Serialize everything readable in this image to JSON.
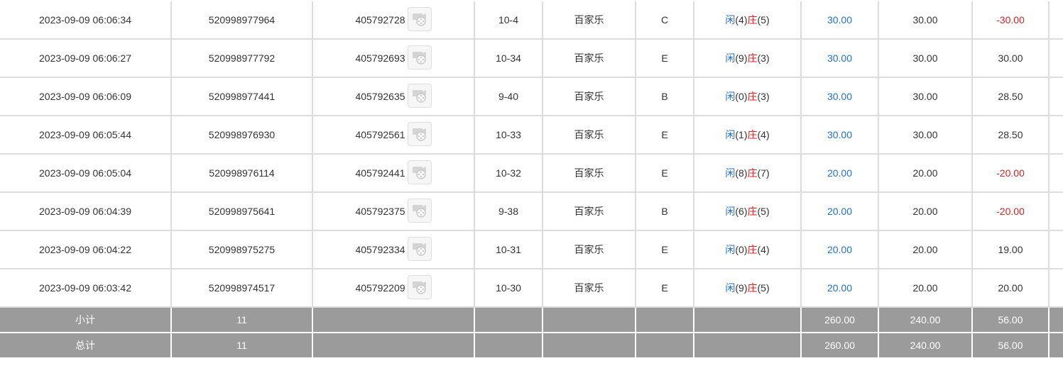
{
  "icons": {
    "video": "video-replay-icon"
  },
  "colors": {
    "bet_amount": "#1f6fd6",
    "negative": "#d82020",
    "summary_bg": "#9b9b9b"
  },
  "rows": [
    {
      "time": "2023-09-09 06:06:34",
      "bet_id": "520998977964",
      "round_id": "405792728",
      "shoe": "10-4",
      "game": "百家乐",
      "table": "C",
      "player_label": "闲",
      "player_score": "(4)",
      "banker_label": "庄",
      "banker_score": "(5)",
      "bet": "30.00",
      "valid_bet": "30.00",
      "win_loss": "-30.00",
      "negative": true
    },
    {
      "time": "2023-09-09 06:06:27",
      "bet_id": "520998977792",
      "round_id": "405792693",
      "shoe": "10-34",
      "game": "百家乐",
      "table": "E",
      "player_label": "闲",
      "player_score": "(9)",
      "banker_label": "庄",
      "banker_score": "(3)",
      "bet": "30.00",
      "valid_bet": "30.00",
      "win_loss": "30.00",
      "negative": false
    },
    {
      "time": "2023-09-09 06:06:09",
      "bet_id": "520998977441",
      "round_id": "405792635",
      "shoe": "9-40",
      "game": "百家乐",
      "table": "B",
      "player_label": "闲",
      "player_score": "(0)",
      "banker_label": "庄",
      "banker_score": "(3)",
      "bet": "30.00",
      "valid_bet": "30.00",
      "win_loss": "28.50",
      "negative": false
    },
    {
      "time": "2023-09-09 06:05:44",
      "bet_id": "520998976930",
      "round_id": "405792561",
      "shoe": "10-33",
      "game": "百家乐",
      "table": "E",
      "player_label": "闲",
      "player_score": "(1)",
      "banker_label": "庄",
      "banker_score": "(4)",
      "bet": "30.00",
      "valid_bet": "30.00",
      "win_loss": "28.50",
      "negative": false
    },
    {
      "time": "2023-09-09 06:05:04",
      "bet_id": "520998976114",
      "round_id": "405792441",
      "shoe": "10-32",
      "game": "百家乐",
      "table": "E",
      "player_label": "闲",
      "player_score": "(8)",
      "banker_label": "庄",
      "banker_score": "(7)",
      "bet": "20.00",
      "valid_bet": "20.00",
      "win_loss": "-20.00",
      "negative": true
    },
    {
      "time": "2023-09-09 06:04:39",
      "bet_id": "520998975641",
      "round_id": "405792375",
      "shoe": "9-38",
      "game": "百家乐",
      "table": "B",
      "player_label": "闲",
      "player_score": "(6)",
      "banker_label": "庄",
      "banker_score": "(5)",
      "bet": "20.00",
      "valid_bet": "20.00",
      "win_loss": "-20.00",
      "negative": true
    },
    {
      "time": "2023-09-09 06:04:22",
      "bet_id": "520998975275",
      "round_id": "405792334",
      "shoe": "10-31",
      "game": "百家乐",
      "table": "E",
      "player_label": "闲",
      "player_score": "(0)",
      "banker_label": "庄",
      "banker_score": "(4)",
      "bet": "20.00",
      "valid_bet": "20.00",
      "win_loss": "19.00",
      "negative": false
    },
    {
      "time": "2023-09-09 06:03:42",
      "bet_id": "520998974517",
      "round_id": "405792209",
      "shoe": "10-30",
      "game": "百家乐",
      "table": "E",
      "player_label": "闲",
      "player_score": "(9)",
      "banker_label": "庄",
      "banker_score": "(5)",
      "bet": "20.00",
      "valid_bet": "20.00",
      "win_loss": "20.00",
      "negative": false
    }
  ],
  "summary": {
    "subtotal": {
      "label": "小计",
      "count": "11",
      "bet": "260.00",
      "valid_bet": "240.00",
      "win_loss": "56.00"
    },
    "total": {
      "label": "总计",
      "count": "11",
      "bet": "260.00",
      "valid_bet": "240.00",
      "win_loss": "56.00"
    }
  }
}
